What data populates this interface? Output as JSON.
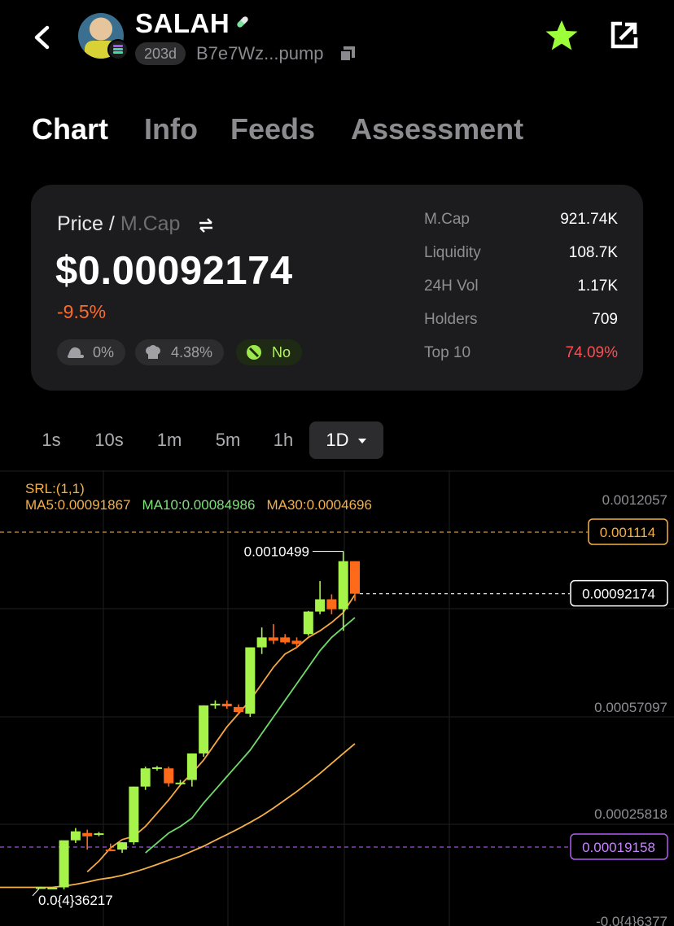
{
  "header": {
    "token_name": "SALAH",
    "age": "203d",
    "address": "B7e7Wz...pump",
    "icons": {
      "back": "chevron-left-icon",
      "copy": "copy-icon",
      "favorite": "star-icon",
      "share": "share-icon",
      "chain": "solana-icon",
      "pill": "pill-icon"
    },
    "favorite_color": "#9dff3a"
  },
  "tabs": [
    {
      "label": "Chart",
      "active": true
    },
    {
      "label": "Info",
      "active": false
    },
    {
      "label": "Feeds",
      "active": false
    },
    {
      "label": "Assessment",
      "active": false
    }
  ],
  "price_card": {
    "label_price": "Price /",
    "label_mcap": "M.Cap",
    "value": "$0.00092174",
    "change": "-9.5%",
    "badges": [
      {
        "icon": "dev-hat-icon",
        "value": "0%"
      },
      {
        "icon": "chef-hat-icon",
        "value": "4.38%"
      },
      {
        "icon": "no-sign-icon",
        "value": "No"
      }
    ],
    "stats": [
      {
        "label": "M.Cap",
        "value": "921.74K"
      },
      {
        "label": "Liquidity",
        "value": "108.7K"
      },
      {
        "label": "24H Vol",
        "value": "1.17K"
      },
      {
        "label": "Holders",
        "value": "709"
      },
      {
        "label": "Top 10",
        "value": "74.09%"
      }
    ]
  },
  "timeframes": [
    "1s",
    "10s",
    "1m",
    "5m",
    "1h",
    "1D"
  ],
  "active_timeframe": "1D",
  "indicators": {
    "srl": "SRL:(1,1)",
    "ma5": "MA5:0.00091867",
    "ma10": "MA10:0.00084986",
    "ma30": "MA30:0.0004696"
  },
  "chart_data": {
    "type": "candlestick",
    "y_axis_labels": [
      "0.0012057",
      "0.00057097",
      "0.00025818",
      "-0.0{4}6377"
    ],
    "markers": {
      "srl_level": "0.001114",
      "last_price": "0.00092174",
      "purple_level": "0.00019158",
      "high_label": "0.0010499",
      "low_label": "0.0{4}36217"
    },
    "colors": {
      "up": "#a6f34a",
      "down": "#ff6a1a",
      "ma5": "#f5a742",
      "ma10": "#6fdc6a",
      "ma30": "#f5b047",
      "srl": "#f5b047",
      "purple": "#b15cf5"
    },
    "candles": [
      {
        "o": 3.6217e-05,
        "h": 3.8e-05,
        "l": 3.2e-05,
        "c": 3.6217e-05
      },
      {
        "o": 3.4e-05,
        "h": 3.6e-05,
        "l": 3.3e-05,
        "c": 3.5e-05
      },
      {
        "o": 3.6e-05,
        "h": 8.5e-05,
        "l": 3e-05,
        "c": 0.000178
      },
      {
        "o": 0.000178,
        "h": 0.000215,
        "l": 0.00017,
        "c": 0.000205
      },
      {
        "o": 0.0002,
        "h": 0.00021,
        "l": 0.00015,
        "c": 0.00019
      },
      {
        "o": 0.000198,
        "h": 0.000203,
        "l": 0.00019,
        "c": 0.000199
      },
      {
        "o": 0.00015,
        "h": 0.000168,
        "l": 0.000145,
        "c": 0.000148
      },
      {
        "o": 0.00015,
        "h": 0.000172,
        "l": 0.00014,
        "c": 0.000172
      },
      {
        "o": 0.000172,
        "h": 0.00034,
        "l": 0.000165,
        "c": 0.00034
      },
      {
        "o": 0.00034,
        "h": 0.0004,
        "l": 0.00033,
        "c": 0.000395
      },
      {
        "o": 0.000395,
        "h": 0.000402,
        "l": 0.000388,
        "c": 0.000398
      },
      {
        "o": 0.000395,
        "h": 0.0004,
        "l": 0.00034,
        "c": 0.00035
      },
      {
        "o": 0.00035,
        "h": 0.00036,
        "l": 0.000345,
        "c": 0.000352
      },
      {
        "o": 0.00036,
        "h": 0.00044,
        "l": 0.00034,
        "c": 0.00044
      },
      {
        "o": 0.00044,
        "h": 0.000585,
        "l": 0.00043,
        "c": 0.000585
      },
      {
        "o": 0.000585,
        "h": 0.0006,
        "l": 0.000575,
        "c": 0.00059
      },
      {
        "o": 0.00059,
        "h": 0.0006,
        "l": 0.000575,
        "c": 0.000582
      },
      {
        "o": 0.00058,
        "h": 0.000588,
        "l": 0.00056,
        "c": 0.000565
      },
      {
        "o": 0.00056,
        "h": 0.00076,
        "l": 0.00055,
        "c": 0.00076
      },
      {
        "o": 0.00076,
        "h": 0.00082,
        "l": 0.00074,
        "c": 0.00079
      },
      {
        "o": 0.00079,
        "h": 0.00083,
        "l": 0.00077,
        "c": 0.00078
      },
      {
        "o": 0.00079,
        "h": 0.0008,
        "l": 0.00077,
        "c": 0.000775
      },
      {
        "o": 0.00078,
        "h": 0.00079,
        "l": 0.00076,
        "c": 0.00077
      },
      {
        "o": 0.0008,
        "h": 0.00087,
        "l": 0.000795,
        "c": 0.000868
      },
      {
        "o": 0.000868,
        "h": 0.00096,
        "l": 0.00086,
        "c": 0.000905
      },
      {
        "o": 0.000905,
        "h": 0.00092,
        "l": 0.00086,
        "c": 0.000875
      },
      {
        "o": 0.000875,
        "h": 0.0010499,
        "l": 0.00081,
        "c": 0.00102
      },
      {
        "o": 0.00102,
        "h": 0.00102,
        "l": 0.0009,
        "c": 0.00092174
      }
    ],
    "ma5": [
      null,
      null,
      null,
      null,
      8.3e-05,
      0.000115,
      0.000155,
      0.00018,
      0.00019,
      0.00022,
      0.00026,
      0.0003,
      0.000345,
      0.00038,
      0.00042,
      0.00047,
      0.00052,
      0.00056,
      0.0006,
      0.00065,
      0.0007,
      0.00074,
      0.00076,
      0.00079,
      0.00081,
      0.000835,
      0.000865,
      0.00091867
    ],
    "ma10": [
      null,
      null,
      null,
      null,
      null,
      null,
      null,
      null,
      null,
      0.00014,
      0.00017,
      0.0002,
      0.00022,
      0.000245,
      0.00029,
      0.00033,
      0.00037,
      0.00041,
      0.00045,
      0.0005,
      0.00055,
      0.0006,
      0.00065,
      0.0007,
      0.00075,
      0.00079,
      0.00082,
      0.00084986
    ],
    "ma30": [
      3.6e-05,
      3.6e-05,
      4e-05,
      4.5e-05,
      5.2e-05,
      6e-05,
      6.5e-05,
      7.2e-05,
      8.2e-05,
      9.3e-05,
      0.000105,
      0.000118,
      0.00013,
      0.000145,
      0.00016,
      0.000178,
      0.000195,
      0.000213,
      0.000232,
      0.000252,
      0.000275,
      0.0003,
      0.000325,
      0.000352,
      0.00038,
      0.00041,
      0.00044,
      0.0004696
    ]
  }
}
